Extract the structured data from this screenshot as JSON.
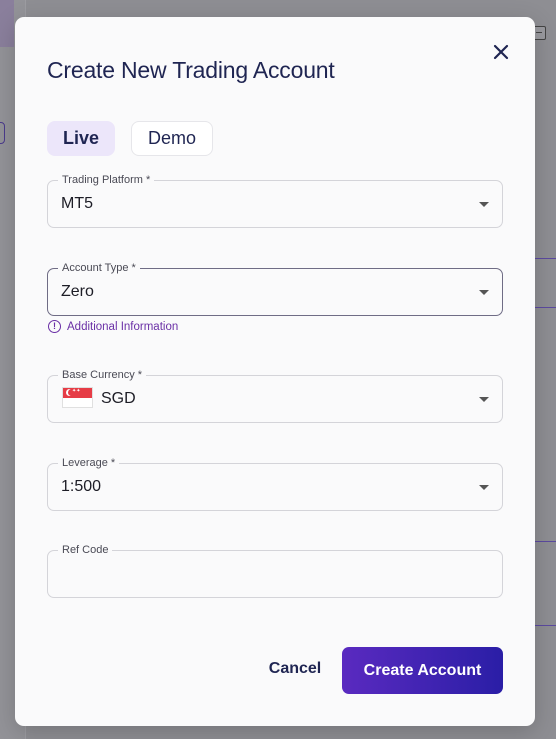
{
  "modal": {
    "title": "Create New Trading Account",
    "close_icon": "close-icon"
  },
  "tabs": [
    {
      "label": "Live",
      "selected": true
    },
    {
      "label": "Demo",
      "selected": false
    }
  ],
  "fields": {
    "trading_platform": {
      "label": "Trading Platform *",
      "value": "MT5"
    },
    "account_type": {
      "label": "Account Type *",
      "value": "Zero"
    },
    "base_currency": {
      "label": "Base Currency *",
      "value": "SGD",
      "flag_icon": "singapore-flag-icon"
    },
    "leverage": {
      "label": "Leverage *",
      "value": "1:500"
    },
    "ref_code": {
      "label": "Ref Code",
      "value": ""
    }
  },
  "additional_info": {
    "text": "Additional Information",
    "icon": "info-icon"
  },
  "footer": {
    "cancel_label": "Cancel",
    "create_label": "Create Account"
  },
  "colors": {
    "title": "#1f2552",
    "accent": "#6a2fa6",
    "button_gradient_start": "#5a2ac0",
    "button_gradient_end": "#2a1ea6",
    "tab_selected_bg": "#ece6fa"
  }
}
